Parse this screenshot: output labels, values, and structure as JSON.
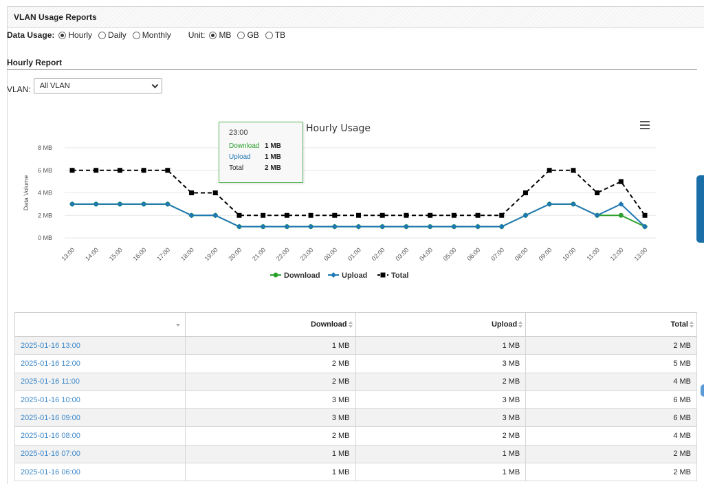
{
  "panel": {
    "title": "VLAN Usage Reports"
  },
  "usage": {
    "label": "Data Usage:",
    "options": [
      {
        "label": "Hourly",
        "checked": true
      },
      {
        "label": "Daily",
        "checked": false
      },
      {
        "label": "Monthly",
        "checked": false
      }
    ],
    "unit_label": "Unit:",
    "units": [
      {
        "label": "MB",
        "checked": true
      },
      {
        "label": "GB",
        "checked": false
      },
      {
        "label": "TB",
        "checked": false
      }
    ]
  },
  "report": {
    "title": "Hourly Report"
  },
  "vlan": {
    "label": "VLAN:",
    "selected": "All VLAN"
  },
  "chart_data": {
    "type": "line",
    "title": "Hourly Usage",
    "ylabel": "Data Volume",
    "xlabel": "",
    "ylim": [
      0,
      8
    ],
    "yticks": [
      "0 MB",
      "2 MB",
      "4 MB",
      "6 MB",
      "8 MB"
    ],
    "categories": [
      "13:00",
      "14:00",
      "15:00",
      "16:00",
      "17:00",
      "18:00",
      "19:00",
      "20:00",
      "21:00",
      "22:00",
      "23:00",
      "00:00",
      "01:00",
      "02:00",
      "03:00",
      "04:00",
      "05:00",
      "06:00",
      "07:00",
      "08:00",
      "09:00",
      "10:00",
      "11:00",
      "12:00",
      "13:00"
    ],
    "series": [
      {
        "name": "Download",
        "color": "#2ca02c",
        "values": [
          3,
          3,
          3,
          3,
          3,
          2,
          2,
          1,
          1,
          1,
          1,
          1,
          1,
          1,
          1,
          1,
          1,
          1,
          1,
          2,
          3,
          3,
          2,
          2,
          1
        ]
      },
      {
        "name": "Upload",
        "color": "#1f77b4",
        "values": [
          3,
          3,
          3,
          3,
          3,
          2,
          2,
          1,
          1,
          1,
          1,
          1,
          1,
          1,
          1,
          1,
          1,
          1,
          1,
          2,
          3,
          3,
          2,
          3,
          1
        ]
      },
      {
        "name": "Total",
        "color": "#000000",
        "values": [
          6,
          6,
          6,
          6,
          6,
          4,
          4,
          2,
          2,
          2,
          2,
          2,
          2,
          2,
          2,
          2,
          2,
          2,
          2,
          4,
          6,
          6,
          4,
          5,
          2
        ]
      }
    ],
    "grid": true,
    "legend": "bottom"
  },
  "tooltip": {
    "time": "23:00",
    "rows": [
      {
        "name": "Download",
        "value": "1 MB",
        "color": "#2ca02c"
      },
      {
        "name": "Upload",
        "value": "1 MB",
        "color": "#1f77b4"
      },
      {
        "name": "Total",
        "value": "2 MB",
        "color": "#222222"
      }
    ]
  },
  "table": {
    "headers": {
      "time": "",
      "download": "Download",
      "upload": "Upload",
      "total": "Total"
    },
    "rows": [
      {
        "time": "2025-01-16 13:00",
        "download": "1 MB",
        "upload": "1 MB",
        "total": "2 MB"
      },
      {
        "time": "2025-01-16 12:00",
        "download": "2 MB",
        "upload": "3 MB",
        "total": "5 MB"
      },
      {
        "time": "2025-01-16 11:00",
        "download": "2 MB",
        "upload": "2 MB",
        "total": "4 MB"
      },
      {
        "time": "2025-01-16 10:00",
        "download": "3 MB",
        "upload": "3 MB",
        "total": "6 MB"
      },
      {
        "time": "2025-01-16 09:00",
        "download": "3 MB",
        "upload": "3 MB",
        "total": "6 MB"
      },
      {
        "time": "2025-01-16 08:00",
        "download": "2 MB",
        "upload": "2 MB",
        "total": "4 MB"
      },
      {
        "time": "2025-01-16 07:00",
        "download": "1 MB",
        "upload": "1 MB",
        "total": "2 MB"
      },
      {
        "time": "2025-01-16 06:00",
        "download": "1 MB",
        "upload": "1 MB",
        "total": "2 MB"
      }
    ]
  }
}
